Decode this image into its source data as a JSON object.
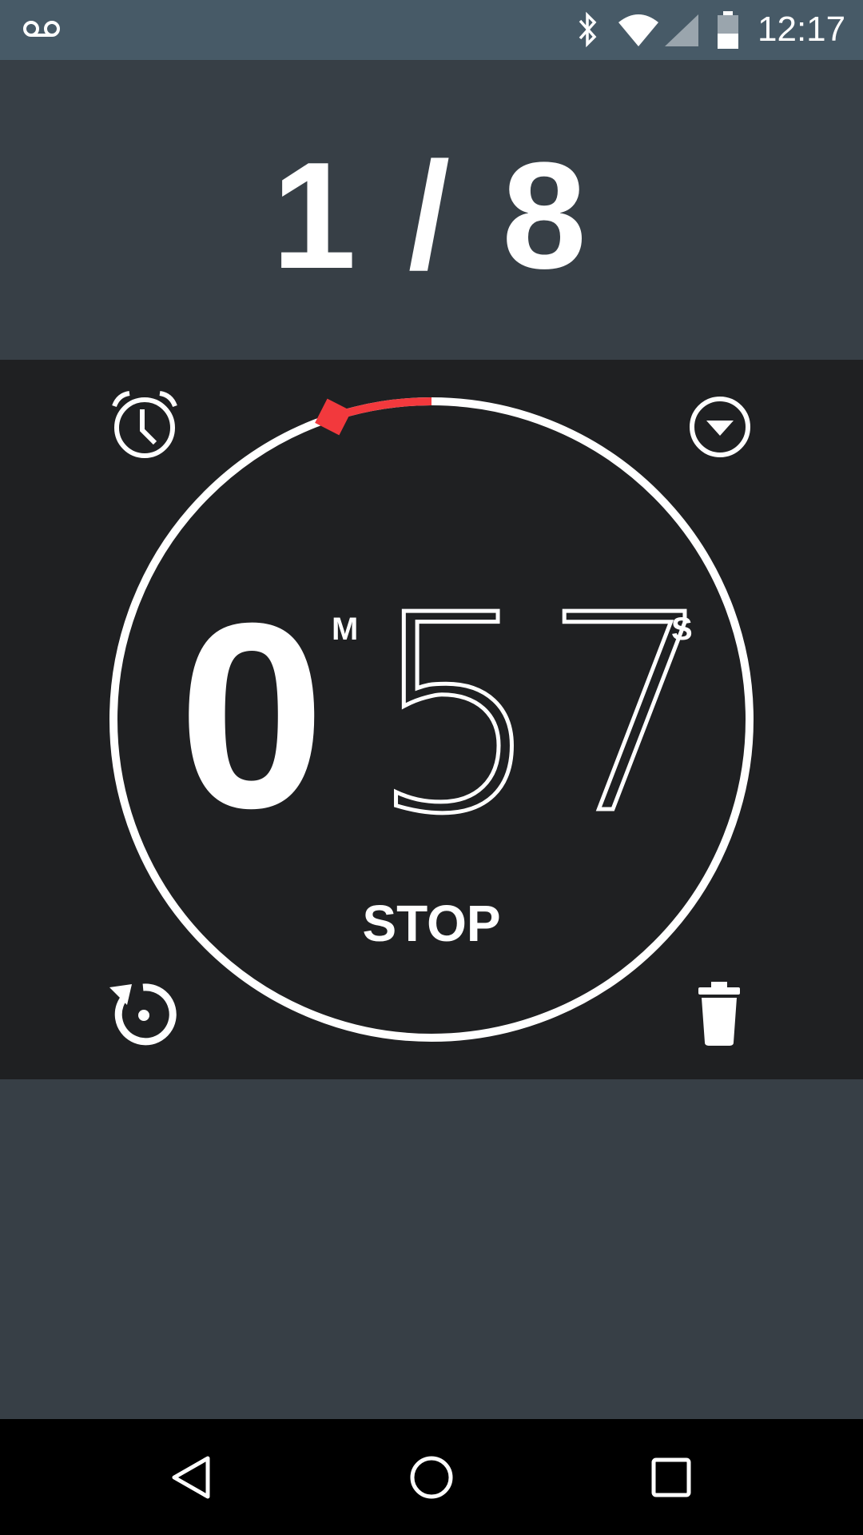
{
  "status_bar": {
    "time": "12:17",
    "icons": [
      "voicemail-icon",
      "bluetooth-icon",
      "wifi-icon",
      "cell-signal-icon",
      "battery-icon"
    ]
  },
  "timer": {
    "index_label": "1 / 8",
    "minutes": "0",
    "minutes_unit": "M",
    "seconds": "57",
    "seconds_unit": "S",
    "stop_label": "STOP",
    "elapsed_fraction": 0.05
  },
  "actions": [
    "alarm-clock-icon",
    "dropdown-circle-icon",
    "reset-icon",
    "trash-icon"
  ],
  "colors": {
    "accent": "#f2393d",
    "panel": "#1f2022",
    "background": "#373f46",
    "status_bar": "#475a67"
  }
}
